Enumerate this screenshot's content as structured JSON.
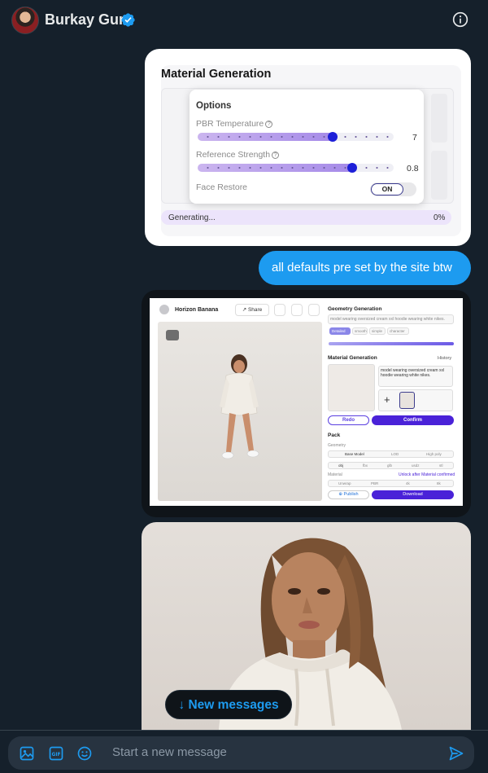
{
  "header": {
    "name": "Burkay Gur",
    "verified_icon": "verified-badge-icon",
    "info_icon": "info-icon"
  },
  "message1": {
    "title": "Material Generation",
    "options_title": "Options",
    "pbr_label": "PBR Temperature",
    "pbr_value": "7",
    "pbr_level": 0.67,
    "ref_label": "Reference Strength",
    "ref_value": "0.8",
    "ref_level": 0.78,
    "face_restore_label": "Face Restore",
    "face_restore_state": "ON",
    "progress_label": "Generating...",
    "progress_value": "0%"
  },
  "message2": {
    "text": "all defaults pre set by the site btw"
  },
  "message3": {
    "user_name": "Horizon Banana",
    "share_label": "Share",
    "geometry_title": "Geometry Generation",
    "geometry_prompt": "model wearing oversized cream xxl hoodie wearing white nikes.",
    "geometry_chips": [
      "Detailed",
      "smooth",
      "simple",
      "character"
    ],
    "material_title": "Material Generation",
    "history_label": "History",
    "material_prompt": "model wearing oversized cream xxl hoodie wearing white nikes.",
    "redo_label": "Redo",
    "confirm_label": "Confirm",
    "pack_title": "Pack",
    "geometry_label": "Geometry",
    "base_model_label": "Base Model",
    "lod_label": "LOD",
    "high_poly_label": "High poly",
    "format_options": [
      "obj",
      "fbx",
      "glb",
      "usdz",
      "stl"
    ],
    "material_label": "Material",
    "unlock_label": "Unlock after Material confirmed",
    "texture_options": [
      "Unwrap",
      "PBR",
      "4k",
      "8k"
    ],
    "publish_label": "Publish",
    "download_label": "Download"
  },
  "new_messages": {
    "label": "↓ New messages"
  },
  "composer": {
    "placeholder": "Start a new message",
    "icons": [
      "image-icon",
      "gif-icon",
      "emoji-icon",
      "send-icon"
    ]
  },
  "colors": {
    "background": "#15202b",
    "accent": "#1d9bf0",
    "bubble_text": "#ffffff"
  }
}
